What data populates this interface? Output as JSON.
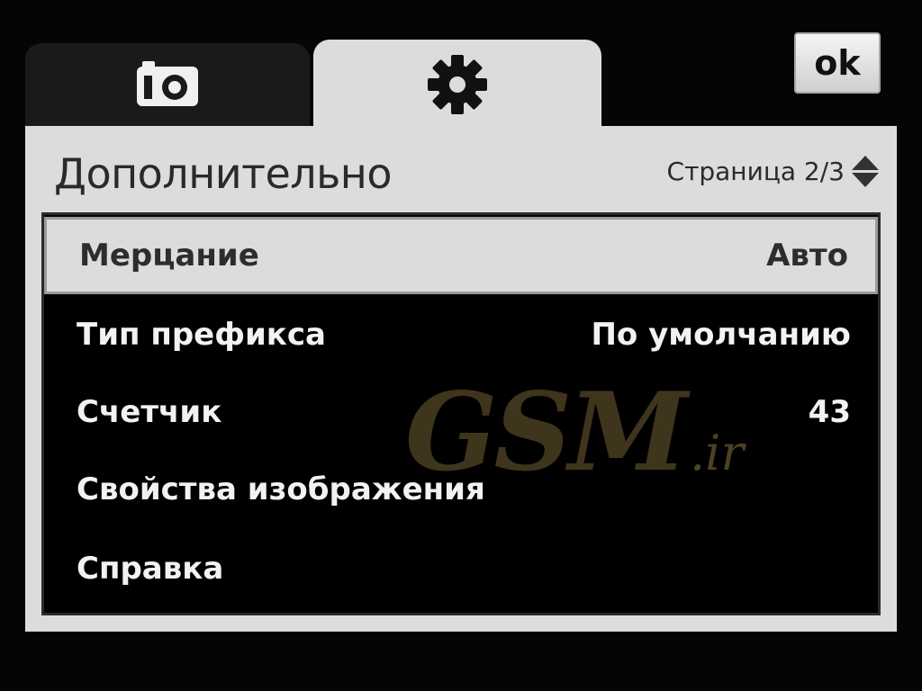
{
  "tabs": [
    {
      "name": "camera",
      "icon": "camera-icon",
      "active": false
    },
    {
      "name": "settings",
      "icon": "gear-icon",
      "active": true
    }
  ],
  "ok_label": "ok",
  "panel": {
    "title": "Дополнительно",
    "pager": "Страница 2/3"
  },
  "items": [
    {
      "label": "Мерцание",
      "value": "Авто",
      "selected": true
    },
    {
      "label": "Тип префикса",
      "value": "По умолчанию",
      "selected": false
    },
    {
      "label": "Счетчик",
      "value": "43",
      "selected": false
    },
    {
      "label": "Свойства изображения",
      "value": "",
      "selected": false
    },
    {
      "label": "Справка",
      "value": "",
      "selected": false
    }
  ],
  "watermark": {
    "main": "GSM",
    "suffix": ".ir"
  },
  "colors": {
    "panel": "#dcdcdc",
    "background": "#050505",
    "list": "#000000",
    "watermark": "#4a3e22"
  }
}
